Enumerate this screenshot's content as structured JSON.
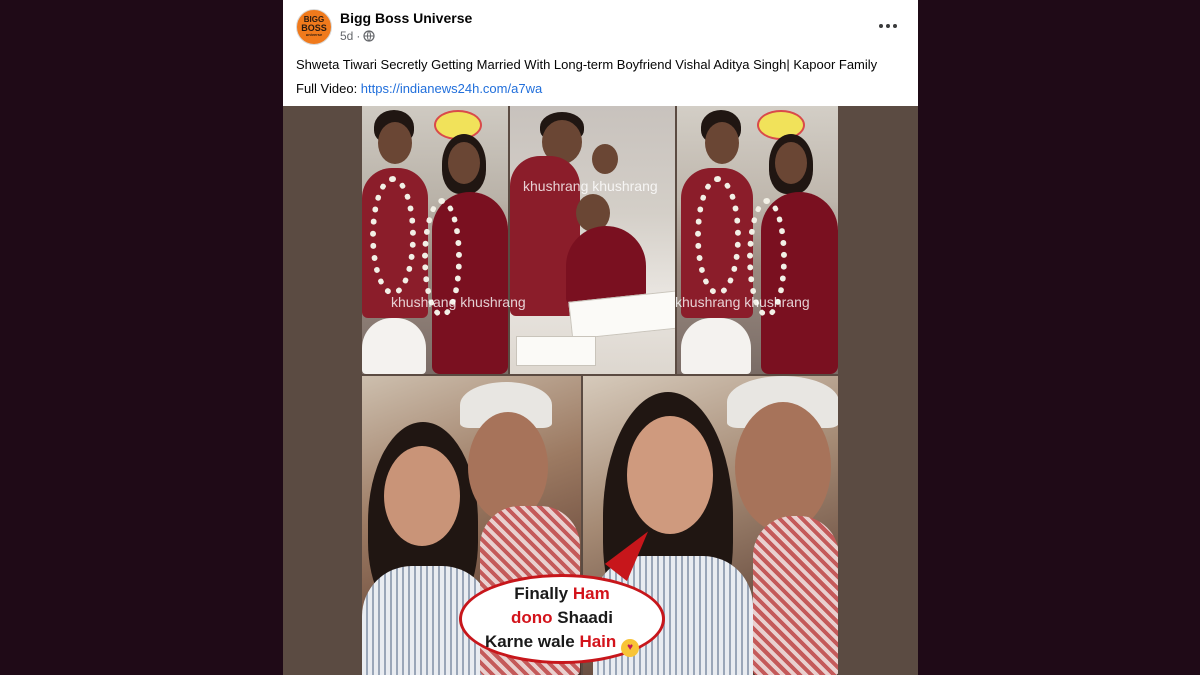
{
  "post": {
    "page_name": "Bigg Boss Universe",
    "timestamp": "5d",
    "separator": "·",
    "avatar_text": [
      "BIGG",
      "BOSS",
      "universe"
    ],
    "caption": "Shweta Tiwari Secretly Getting Married With Long-term Boyfriend Vishal Aditya Singh| Kapoor Family",
    "full_video_label": "Full Video: ",
    "link": "https://indianews24h.com/a7wa",
    "more_icon": "more-horizontal-icon",
    "privacy_icon": "globe-icon"
  },
  "media": {
    "watermark_1": "khushrang khushrang",
    "watermark_2": "khushrang khushrang",
    "watermark_3": "khushrang khushrang",
    "bubble": {
      "line1_a": "Finally ",
      "line1_b": "Ham",
      "line2_a": "dono",
      "line2_b": " Shaadi",
      "line3_a": "Karne wale ",
      "line3_b": "Hain",
      "emoji": "smiling-face-with-hearts-emoji"
    }
  },
  "colors": {
    "background": "#1f0a17",
    "link": "#216fdb",
    "bubble_accent": "#c7161b",
    "avatar": "#f07a1c"
  }
}
